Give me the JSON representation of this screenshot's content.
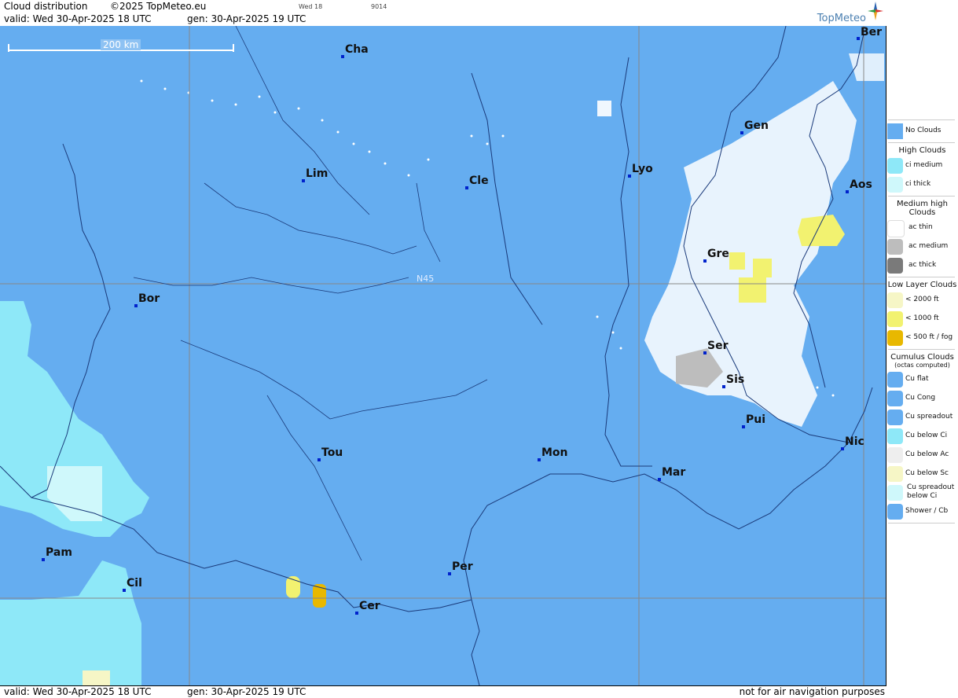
{
  "header": {
    "title": "Cloud distribution",
    "copyright": "©2025 TopMeteo.eu",
    "valid_line": "valid:  Wed  30-Apr-2025  18 UTC",
    "gen_line": "gen:  30-Apr-2025 19 UTC",
    "small_label_1": "Wed 18",
    "small_label_2": "9014",
    "logo_text": "TopMeteo"
  },
  "map": {
    "scale_label": "200 km",
    "latitude_label": "N45",
    "cities": [
      {
        "name": "Cha"
      },
      {
        "name": "Ber"
      },
      {
        "name": "Gen"
      },
      {
        "name": "Lim"
      },
      {
        "name": "Cle"
      },
      {
        "name": "Lyo"
      },
      {
        "name": "Aos"
      },
      {
        "name": "Gre"
      },
      {
        "name": "Bor"
      },
      {
        "name": "Ser"
      },
      {
        "name": "Sis"
      },
      {
        "name": "Pui"
      },
      {
        "name": "Tou"
      },
      {
        "name": "Mon"
      },
      {
        "name": "Mar"
      },
      {
        "name": "Nic"
      },
      {
        "name": "Pam"
      },
      {
        "name": "Cil"
      },
      {
        "name": "Per"
      },
      {
        "name": "Cer"
      }
    ]
  },
  "footer": {
    "valid_line": "valid:  Wed  30-Apr-2025  18 UTC",
    "gen_line": "gen:  30-Apr-2025 19 UTC",
    "disclaimer": "not for air navigation purposes"
  },
  "legend": {
    "no_clouds": "No Clouds",
    "high_title": "High Clouds",
    "ci_medium": "ci medium",
    "ci_thick": "ci thick",
    "medium_title": "Medium high Clouds",
    "ac_thin": "ac thin",
    "ac_medium": "ac medium",
    "ac_thick": "ac thick",
    "low_title": "Low Layer Clouds",
    "low_2000": "< 2000 ft",
    "low_1000": "< 1000 ft",
    "low_500": "< 500 ft / fog",
    "cu_title": "Cumulus Clouds",
    "cu_subtitle": "(octas computed)",
    "cu_flat": "Cu flat",
    "cu_cong": "Cu Cong",
    "cu_spread": "Cu spreadout",
    "cu_below_ci": "Cu below Ci",
    "cu_below_ac": "Cu below Ac",
    "cu_below_sc": "Cu below Sc",
    "cu_spread_below_ci": "Cu spreadout below Ci",
    "shower": "Shower / Cb",
    "colors": {
      "no_clouds": "#65adf0",
      "ci_medium": "#8ee8f8",
      "ci_thick": "#cff8fb",
      "ac_thin": "#ffffff",
      "ac_medium": "#bdbdbd",
      "ac_thick": "#7a7a7a",
      "low_2000": "#f6f6c6",
      "low_1000": "#f2f270",
      "low_500": "#e8b800"
    }
  }
}
